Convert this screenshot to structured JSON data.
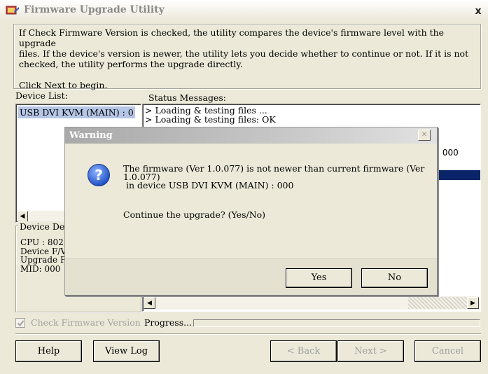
{
  "window": {
    "title": "Firmware Upgrade Utility",
    "close_glyph": "x",
    "icon": "firmware-app-icon"
  },
  "info": {
    "line1": "If Check Firmware Version is checked, the utility compares the device's firmware level with the upgrade",
    "line2": "files. If the device's version is newer, the utility lets you decide whether to continue or not. If it is not",
    "line3": "checked, the utility performs the upgrade directly.",
    "line4": "Click Next to begin."
  },
  "device_list": {
    "label": "Device List:",
    "items": [
      "USB DVI KVM (MAIN) : 0"
    ]
  },
  "status": {
    "label": "Status Messages:",
    "lines": [
      "> Loading & testing files ...",
      "> Loading & testing files: OK"
    ],
    "partial_text": ": 000"
  },
  "device_detail": {
    "label": "Device De",
    "lines": [
      "CPU : 802",
      "Device F/V",
      "Upgrade F",
      "MID: 000"
    ]
  },
  "check_firmware": {
    "label": "Check Firmware Version",
    "checked": true
  },
  "progress": {
    "label": "Progress...",
    "value": 0
  },
  "buttons": {
    "help": "Help",
    "view_log": "View Log",
    "back": "< Back",
    "next": "Next >",
    "cancel": "Cancel"
  },
  "dialog": {
    "title": "Warning",
    "close_glyph": "✕",
    "icon": "question-icon",
    "message_line1": "The firmware (Ver 1.0.077) is not newer than current firmware (Ver",
    "message_line2": "1.0.077)",
    "message_line3": "in device USB DVI KVM (MAIN) : 000",
    "question": "Continue the upgrade? (Yes/No)",
    "yes": "Yes",
    "no": "No"
  },
  "colors": {
    "selection": "#b6c6e6",
    "highlight_bar": "#0a246a",
    "face": "#ece9d8"
  }
}
